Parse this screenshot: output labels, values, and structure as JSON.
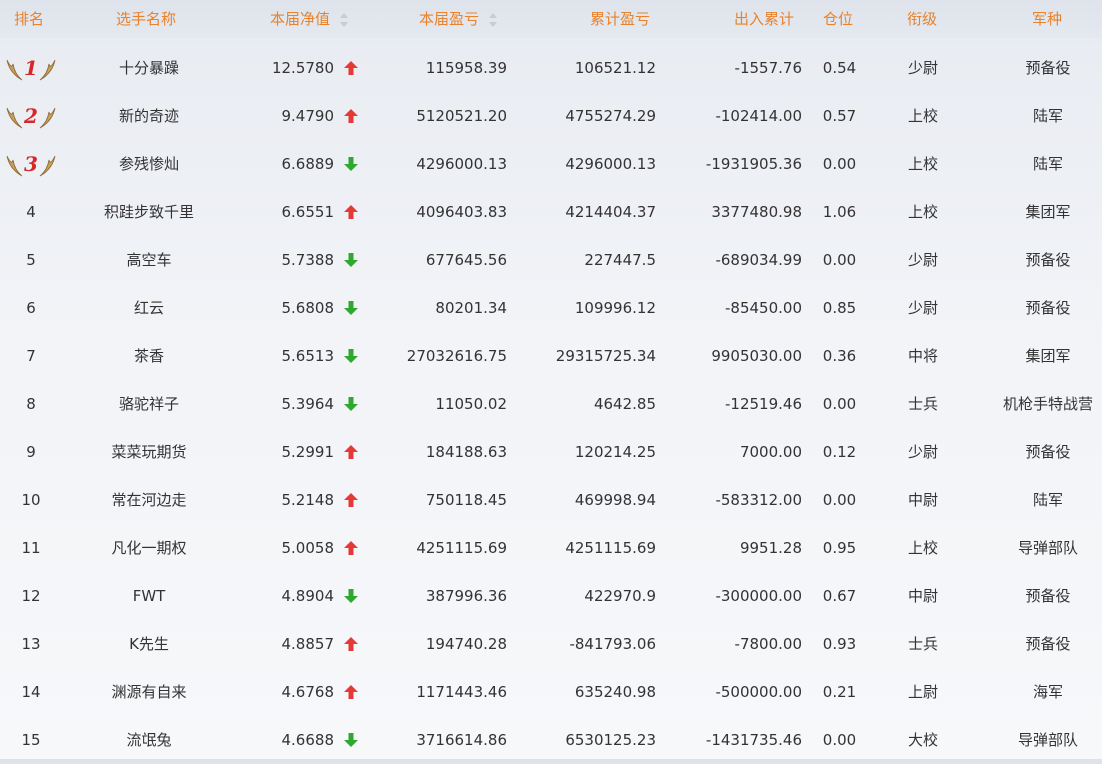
{
  "headers": [
    "排名",
    "选手名称",
    "本届净值",
    "本届盈亏",
    "累计盈亏",
    "出入累计",
    "仓位",
    "衔级",
    "军种"
  ],
  "colors": {
    "header_text": "#e8822c",
    "up": "#e53935",
    "down": "#2ea82e",
    "medal_number": "#d62828",
    "wing": "#c9a05a"
  },
  "rows": [
    {
      "rank": "1",
      "name": "十分暴躁",
      "nav": "12.5780",
      "trend": "up",
      "pnl": "115958.39",
      "total_pnl": "106521.12",
      "flow": "-1557.76",
      "position": "0.54",
      "rank_title": "少尉",
      "branch": "预备役",
      "medal": true
    },
    {
      "rank": "2",
      "name": "新的奇迹",
      "nav": "9.4790",
      "trend": "up",
      "pnl": "5120521.20",
      "total_pnl": "4755274.29",
      "flow": "-102414.00",
      "position": "0.57",
      "rank_title": "上校",
      "branch": "陆军",
      "medal": true
    },
    {
      "rank": "3",
      "name": "参残惨灿",
      "nav": "6.6889",
      "trend": "down",
      "pnl": "4296000.13",
      "total_pnl": "4296000.13",
      "flow": "-1931905.36",
      "position": "0.00",
      "rank_title": "上校",
      "branch": "陆军",
      "medal": true
    },
    {
      "rank": "4",
      "name": "积跬步致千里",
      "nav": "6.6551",
      "trend": "up",
      "pnl": "4096403.83",
      "total_pnl": "4214404.37",
      "flow": "3377480.98",
      "position": "1.06",
      "rank_title": "上校",
      "branch": "集团军",
      "medal": false
    },
    {
      "rank": "5",
      "name": "高空车",
      "nav": "5.7388",
      "trend": "down",
      "pnl": "677645.56",
      "total_pnl": "227447.5",
      "flow": "-689034.99",
      "position": "0.00",
      "rank_title": "少尉",
      "branch": "预备役",
      "medal": false
    },
    {
      "rank": "6",
      "name": "红云",
      "nav": "5.6808",
      "trend": "down",
      "pnl": "80201.34",
      "total_pnl": "109996.12",
      "flow": "-85450.00",
      "position": "0.85",
      "rank_title": "少尉",
      "branch": "预备役",
      "medal": false
    },
    {
      "rank": "7",
      "name": "茶香",
      "nav": "5.6513",
      "trend": "down",
      "pnl": "27032616.75",
      "total_pnl": "29315725.34",
      "flow": "9905030.00",
      "position": "0.36",
      "rank_title": "中将",
      "branch": "集团军",
      "medal": false
    },
    {
      "rank": "8",
      "name": "骆驼祥子",
      "nav": "5.3964",
      "trend": "down",
      "pnl": "11050.02",
      "total_pnl": "4642.85",
      "flow": "-12519.46",
      "position": "0.00",
      "rank_title": "士兵",
      "branch": "机枪手特战营",
      "medal": false
    },
    {
      "rank": "9",
      "name": "菜菜玩期货",
      "nav": "5.2991",
      "trend": "up",
      "pnl": "184188.63",
      "total_pnl": "120214.25",
      "flow": "7000.00",
      "position": "0.12",
      "rank_title": "少尉",
      "branch": "预备役",
      "medal": false
    },
    {
      "rank": "10",
      "name": "常在河边走",
      "nav": "5.2148",
      "trend": "up",
      "pnl": "750118.45",
      "total_pnl": "469998.94",
      "flow": "-583312.00",
      "position": "0.00",
      "rank_title": "中尉",
      "branch": "陆军",
      "medal": false
    },
    {
      "rank": "11",
      "name": "凡化一期权",
      "nav": "5.0058",
      "trend": "up",
      "pnl": "4251115.69",
      "total_pnl": "4251115.69",
      "flow": "9951.28",
      "position": "0.95",
      "rank_title": "上校",
      "branch": "导弹部队",
      "medal": false
    },
    {
      "rank": "12",
      "name": "FWT",
      "nav": "4.8904",
      "trend": "down",
      "pnl": "387996.36",
      "total_pnl": "422970.9",
      "flow": "-300000.00",
      "position": "0.67",
      "rank_title": "中尉",
      "branch": "预备役",
      "medal": false
    },
    {
      "rank": "13",
      "name": "K先生",
      "nav": "4.8857",
      "trend": "up",
      "pnl": "194740.28",
      "total_pnl": "-841793.06",
      "flow": "-7800.00",
      "position": "0.93",
      "rank_title": "士兵",
      "branch": "预备役",
      "medal": false
    },
    {
      "rank": "14",
      "name": "渊源有自来",
      "nav": "4.6768",
      "trend": "up",
      "pnl": "1171443.46",
      "total_pnl": "635240.98",
      "flow": "-500000.00",
      "position": "0.21",
      "rank_title": "上尉",
      "branch": "海军",
      "medal": false
    },
    {
      "rank": "15",
      "name": "流氓兔",
      "nav": "4.6688",
      "trend": "down",
      "pnl": "3716614.86",
      "total_pnl": "6530125.23",
      "flow": "-1431735.46",
      "position": "0.00",
      "rank_title": "大校",
      "branch": "导弹部队",
      "medal": false
    }
  ]
}
